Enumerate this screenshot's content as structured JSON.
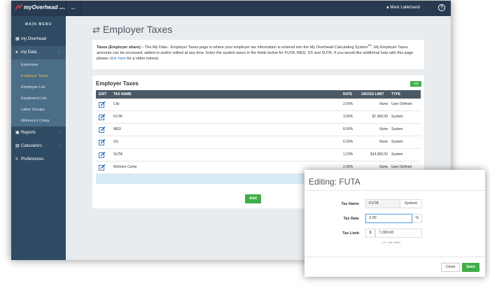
{
  "app": {
    "logo": "myOverhead",
    "logo_sub": ".com",
    "user": "Mark Lallemand",
    "help": "?"
  },
  "sidebar": {
    "title": "MAIN MENU",
    "items": [
      {
        "label": "my Overhead",
        "icon": "grid-icon"
      },
      {
        "label": "my Data",
        "icon": "user-icon"
      },
      {
        "label": "Reports",
        "icon": "report-icon"
      },
      {
        "label": "Calculators",
        "icon": "calculator-icon"
      },
      {
        "label": "Preferences",
        "icon": "sliders-icon"
      }
    ],
    "subitems": [
      {
        "label": "Expenses"
      },
      {
        "label": "Employer Taxes"
      },
      {
        "label": "Employee List"
      },
      {
        "label": "Equipment List"
      },
      {
        "label": "Labor Groups"
      },
      {
        "label": "Workers's Comp"
      }
    ]
  },
  "page": {
    "title": "Employer Taxes",
    "info_bold": "Taxes (Employer share)",
    "info_text": " – The My Data - Employer Taxes page is where your employer tax information is entered into the My Overhead Calculating System",
    "info_sm": "SM",
    "info_text2": ". My Employer Taxes amounts can be accessed, added to and/or edited at any time. Enter the system taxes in the fields below for FUTA, MED, SS and SUTA. If you would like additional help with this page please ",
    "info_link": "click here",
    "info_text3": " for a video tutorial."
  },
  "table": {
    "title": "Employer Taxes",
    "add_small": "Add",
    "add_button": "Add",
    "headers": [
      "EDIT",
      "TAX NAME",
      "RATE",
      "GROSS LIMIT",
      "TYPE"
    ],
    "rows": [
      {
        "name": "City",
        "rate": "2.00%",
        "limit": "None",
        "type": "User Defined"
      },
      {
        "name": "FUTA",
        "rate": "3.00%",
        "limit": "$7,000.00",
        "type": "System"
      },
      {
        "name": "MED",
        "rate": "8.00%",
        "limit": "None",
        "type": "System"
      },
      {
        "name": "SS",
        "rate": "6.20%",
        "limit": "None",
        "type": "System"
      },
      {
        "name": "SUTA",
        "rate": "1.23%",
        "limit": "$14,000.00",
        "type": "System"
      },
      {
        "name": "Workers Comp",
        "rate": "2.00%",
        "limit": "None",
        "type": "User Defined"
      }
    ]
  },
  "modal": {
    "title": "Editing: FUTA",
    "tax_name_label": "Tax Name",
    "tax_name_value": "FUTA",
    "tax_type": "System",
    "tax_rate_label": "Tax Rate",
    "tax_rate_value": "3.00",
    "tax_rate_unit": "%",
    "tax_limit_label": "Tax Limit",
    "tax_limit_currency": "$",
    "tax_limit_value": "7,000.00",
    "hint": "( 0 = No Limit )",
    "close_label": "Close",
    "save_label": "Save"
  },
  "colors": {
    "sidebar": "#2f4b63",
    "topbar": "#283a4f",
    "accent_green": "#3fae49",
    "active_sub": "#f1b24a"
  }
}
